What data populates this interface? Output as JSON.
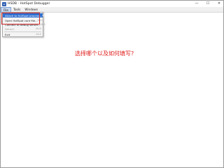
{
  "window": {
    "title": "HSDB - HotSpot Debugger",
    "controls": {
      "minimize": "—",
      "maximize": "☐",
      "close": "✕"
    }
  },
  "menubar": {
    "items": [
      {
        "label": "File",
        "active": true
      },
      {
        "label": "Tools",
        "active": false
      },
      {
        "label": "Windows",
        "active": false
      }
    ]
  },
  "file_menu": {
    "items": [
      {
        "label": "Attach to HotSpot process...",
        "shortcut": "Alt-A",
        "enabled": true,
        "highlighted": true
      },
      {
        "label": "Open HotSpot core file...",
        "shortcut": "Alt-C",
        "enabled": true,
        "highlighted": false
      },
      {
        "label": "Connect to debug server...",
        "shortcut": "Alt-S",
        "enabled": true,
        "highlighted": false
      },
      {
        "label": "Detach",
        "shortcut": "Alt-D",
        "enabled": false,
        "highlighted": false
      },
      {
        "label": "Exit",
        "shortcut": "Alt-X",
        "enabled": true,
        "highlighted": false
      }
    ]
  },
  "annotation": {
    "text": "选择哪个以及如何填写?",
    "color": "#e02020"
  },
  "colors": {
    "highlight": "#2f6fd0",
    "annotation_box": "#d22a2a",
    "menu_background": "#f4f4f4"
  }
}
